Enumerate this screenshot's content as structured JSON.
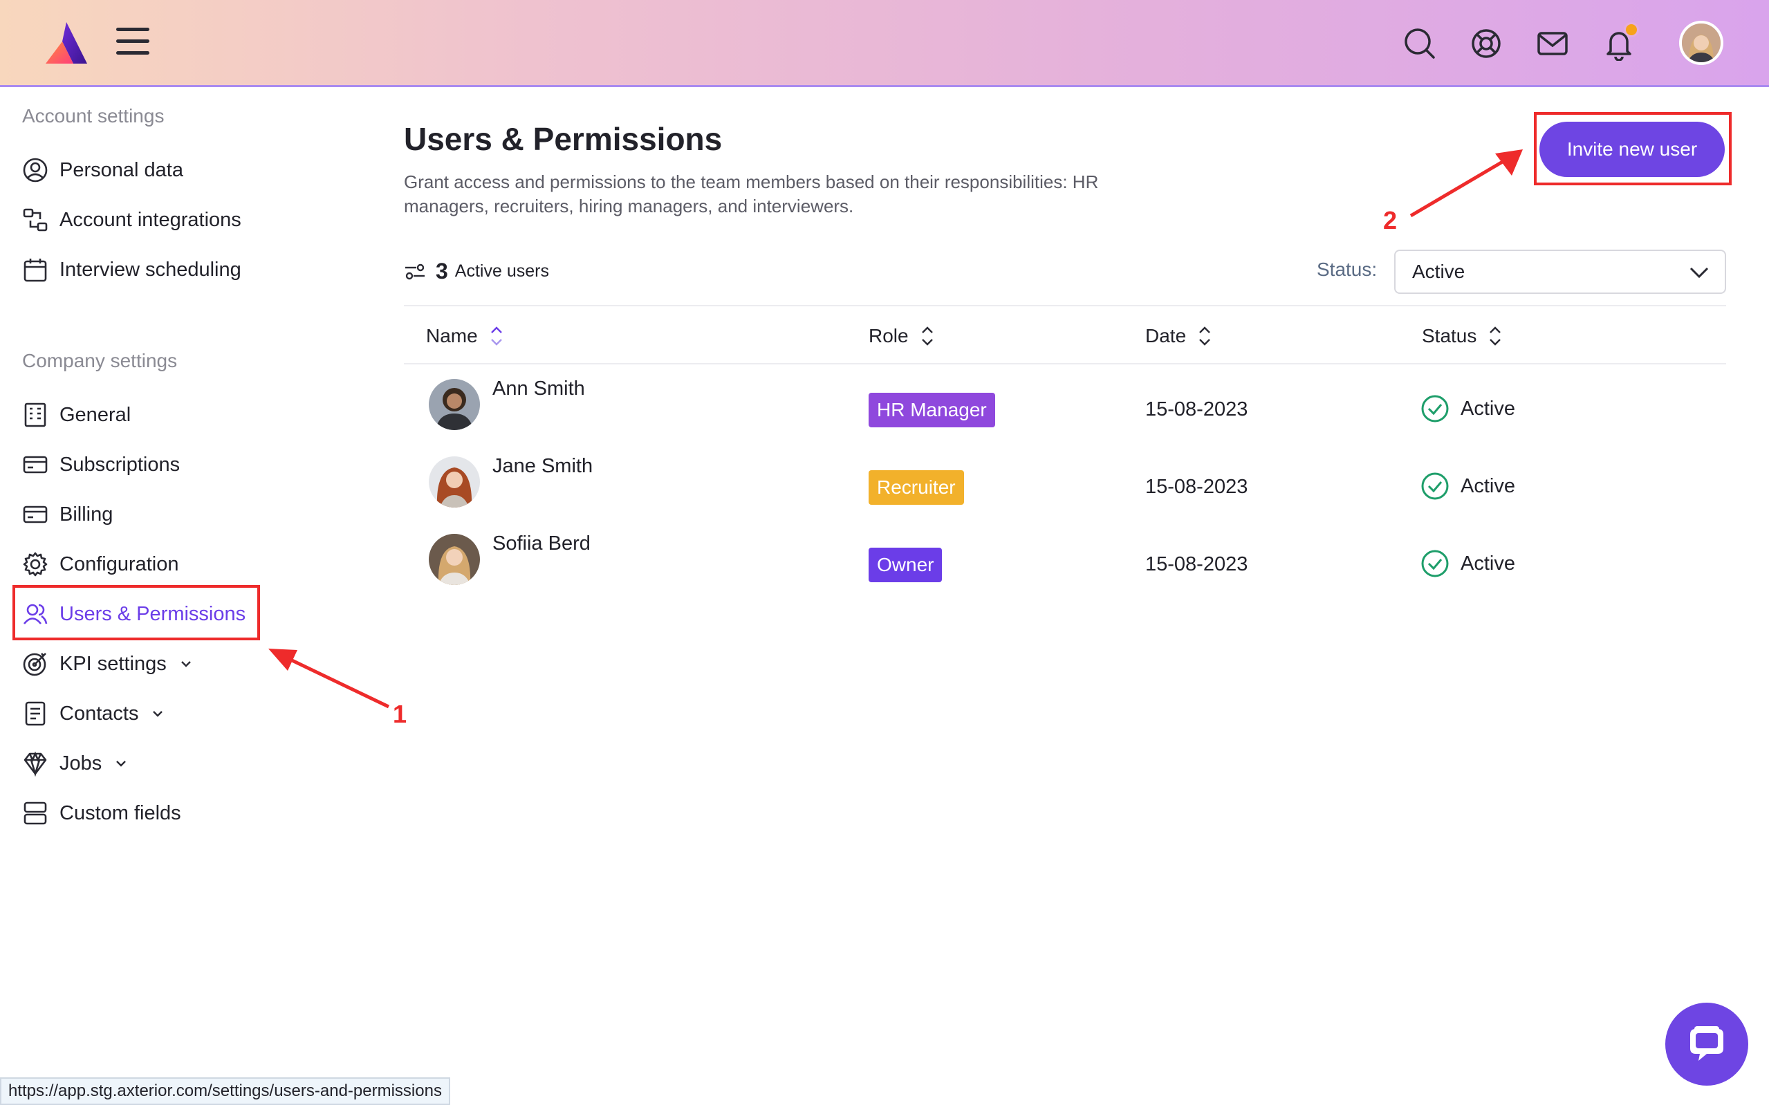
{
  "colors": {
    "accent": "#6e45e3",
    "active_nav": "#6b3de8",
    "success": "#1e9e6a",
    "hr_badge": "#8f48dd",
    "recruiter_badge": "#f2b12b",
    "owner_badge": "#6b3de8",
    "annotation": "#ee2b2b"
  },
  "header": {
    "icons": [
      "menu-icon",
      "search-icon",
      "help-icon",
      "mail-icon",
      "bell-icon"
    ],
    "has_notification": true
  },
  "sidebar": {
    "account_title": "Account settings",
    "account_items": [
      {
        "label": "Personal data",
        "icon": "user-circle-icon"
      },
      {
        "label": "Account integrations",
        "icon": "integrations-icon"
      },
      {
        "label": "Interview scheduling",
        "icon": "calendar-icon"
      }
    ],
    "company_title": "Company settings",
    "company_items": [
      {
        "label": "General",
        "icon": "building-icon"
      },
      {
        "label": "Subscriptions",
        "icon": "card-icon"
      },
      {
        "label": "Billing",
        "icon": "card-icon"
      },
      {
        "label": "Configuration",
        "icon": "gear-icon"
      },
      {
        "label": "Users & Permissions",
        "icon": "users-icon",
        "active": true
      },
      {
        "label": "KPI settings",
        "icon": "target-icon",
        "expandable": true
      },
      {
        "label": "Contacts",
        "icon": "document-icon",
        "expandable": true
      },
      {
        "label": "Jobs",
        "icon": "diamond-icon",
        "expandable": true
      },
      {
        "label": "Custom fields",
        "icon": "fields-icon"
      }
    ]
  },
  "main": {
    "title": "Users & Permissions",
    "description": "Grant access and permissions to the team members based on their responsibilities: HR managers, recruiters, hiring managers, and interviewers.",
    "invite_label": "Invite new user",
    "active_count": "3",
    "active_users_label": "Active users",
    "status_filter_label": "Status:",
    "status_filter_value": "Active",
    "columns": [
      "Name",
      "Role",
      "Date",
      "Status"
    ],
    "users": [
      {
        "name": "Ann Smith",
        "role": "HR Manager",
        "date": "15-08-2023",
        "status": "Active"
      },
      {
        "name": "Jane Smith",
        "role": "Recruiter",
        "date": "15-08-2023",
        "status": "Active"
      },
      {
        "name": "Sofiia Berd",
        "role": "Owner",
        "date": "15-08-2023",
        "status": "Active"
      }
    ]
  },
  "annotations": {
    "marker_1": "1",
    "marker_2": "2"
  },
  "status_bar": {
    "url": "https://app.stg.axterior.com/settings/users-and-permissions"
  }
}
